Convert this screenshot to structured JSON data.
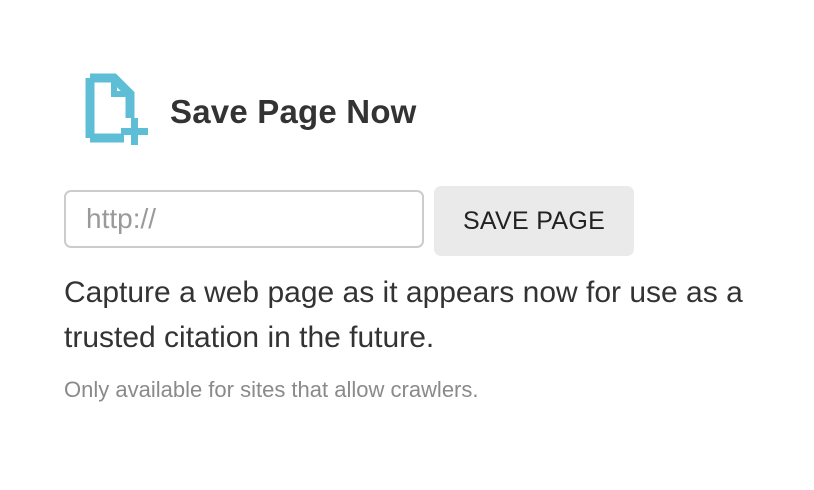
{
  "header": {
    "icon": "add-document-icon",
    "title": "Save Page Now"
  },
  "form": {
    "url_placeholder": "http://",
    "url_value": "",
    "save_label": "SAVE PAGE"
  },
  "description": "Capture a web page as it appears now for use as a trusted citation in the future.",
  "note": "Only available for sites that allow crawlers.",
  "colors": {
    "icon_accent": "#5ebed6",
    "text": "#333333",
    "button_bg": "#eaeaea",
    "input_border": "#cccccc",
    "note_text": "#8a8a8a"
  }
}
